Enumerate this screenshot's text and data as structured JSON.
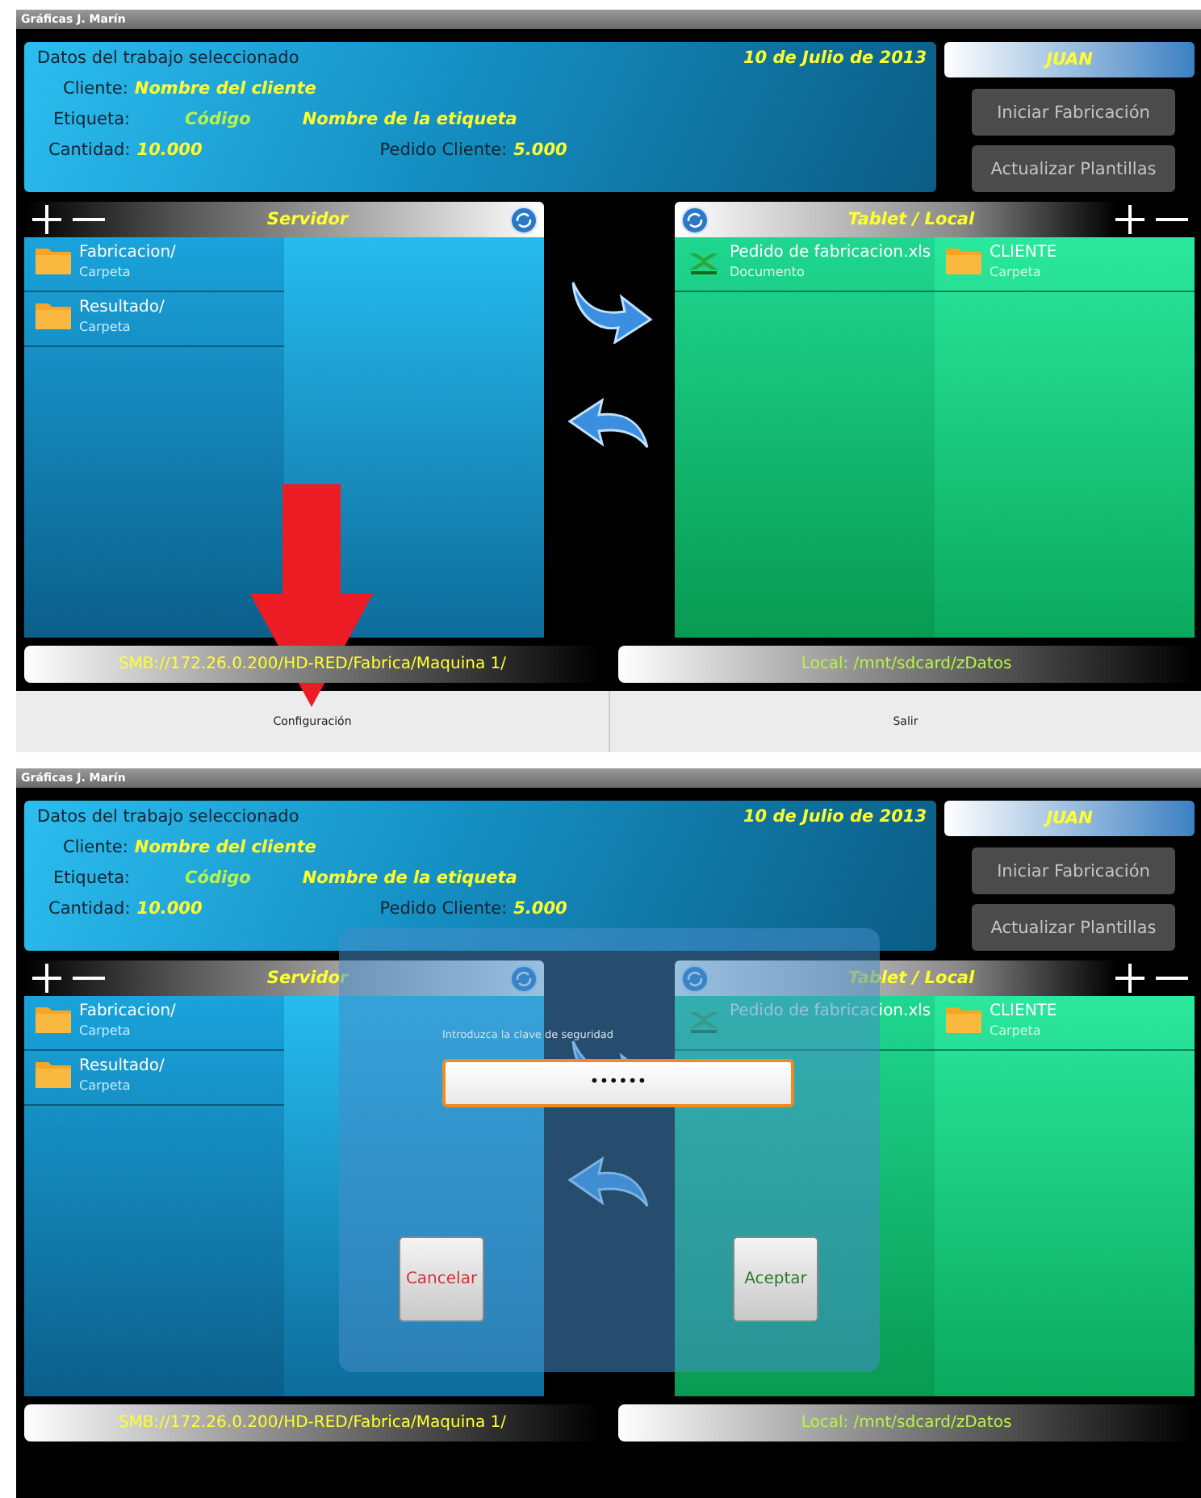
{
  "screens": [
    {
      "title": "Gráficas J. Marín",
      "job": {
        "heading": "Datos del trabajo seleccionado",
        "date": "10 de Julio de 2013",
        "client_label": "Cliente:",
        "client": "Nombre del cliente",
        "label_label": "Etiqueta:",
        "label_code": "Código",
        "label_name": "Nombre de la etiqueta",
        "quantity_label": "Cantidad:",
        "quantity": "10.000",
        "order_label": "Pedido Cliente:",
        "order": "5.000"
      },
      "user": "JUAN",
      "actions": [
        "Iniciar Fabricación",
        "Actualizar Plantillas"
      ],
      "panels": [
        {
          "kind": "server",
          "title": "Servidor",
          "path": "SMB://172.26.0.200/HD-RED/Fabrica/Maquina 1/",
          "columns": [
            [
              {
                "kind": "folder",
                "name": "Fabricacion/",
                "type": "Carpeta"
              },
              {
                "kind": "folder",
                "name": "Resultado/",
                "type": "Carpeta"
              }
            ],
            []
          ]
        },
        {
          "kind": "local",
          "title": "Tablet / Local",
          "path": "Local: /mnt/sdcard/zDatos",
          "columns": [
            [
              {
                "kind": "spreadsheet",
                "name": "Pedido de fabricacion.xls",
                "type": "Documento"
              }
            ],
            [
              {
                "kind": "folder",
                "name": "CLIENTE",
                "type": "Carpeta"
              }
            ]
          ]
        }
      ],
      "bottom_buttons": [
        "Configuración",
        "Salir"
      ],
      "annotation": {
        "kind": "arrow"
      }
    },
    {
      "title": "Gráficas J. Marín",
      "job": {
        "heading": "Datos del trabajo seleccionado",
        "date": "10 de Julio de 2013",
        "client_label": "Cliente:",
        "client": "Nombre del cliente",
        "label_label": "Etiqueta:",
        "label_code": "Código",
        "label_name": "Nombre de la etiqueta",
        "quantity_label": "Cantidad:",
        "quantity": "10.000",
        "order_label": "Pedido Cliente:",
        "order": "5.000"
      },
      "user": "JUAN",
      "actions": [
        "Iniciar Fabricación",
        "Actualizar Plantillas"
      ],
      "panels": [
        {
          "kind": "server",
          "title": "Servidor",
          "path": "SMB://172.26.0.200/HD-RED/Fabrica/Maquina 1/",
          "columns": [
            [
              {
                "kind": "folder",
                "name": "Fabricacion/",
                "type": "Carpeta"
              },
              {
                "kind": "folder",
                "name": "Resultado/",
                "type": "Carpeta"
              }
            ],
            []
          ]
        },
        {
          "kind": "local",
          "title": "Tablet / Local",
          "path": "Local: /mnt/sdcard/zDatos",
          "columns": [
            [
              {
                "kind": "spreadsheet",
                "name": "Pedido de fabricacion.xls"
              }
            ],
            [
              {
                "kind": "folder",
                "name": "CLIENTE",
                "type": "Carpeta"
              }
            ]
          ]
        }
      ],
      "dialog": {
        "prompt": "Introduzca la clave de seguridad",
        "value": "••••••",
        "buttons": [
          {
            "label": "Cancelar",
            "kind": "cancel"
          },
          {
            "label": "Aceptar",
            "kind": "confirm"
          }
        ]
      }
    }
  ]
}
